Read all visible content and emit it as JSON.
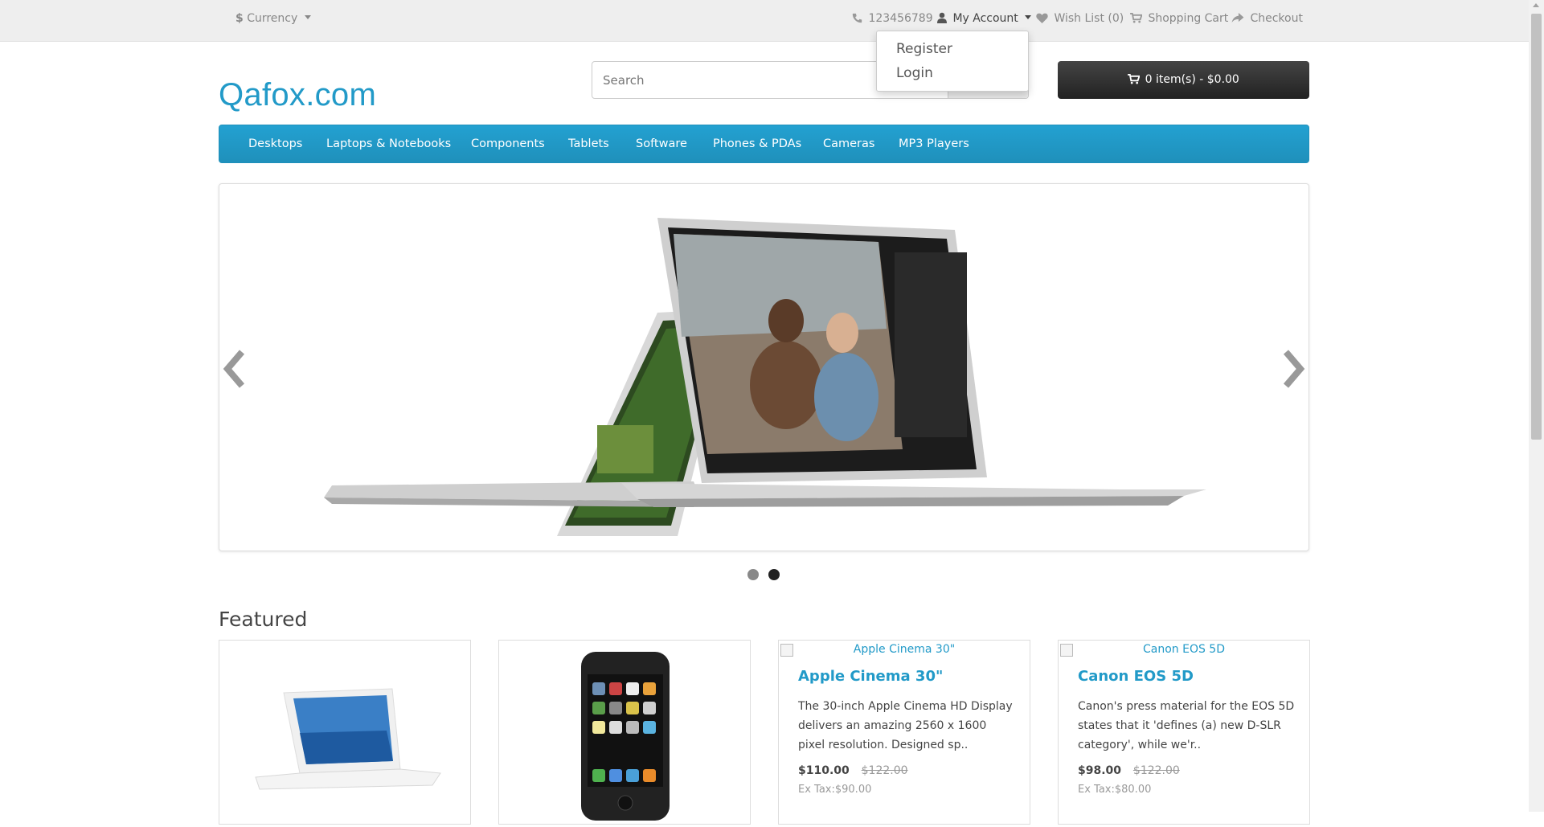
{
  "topbar": {
    "currency_label": "Currency",
    "phone": "123456789",
    "my_account": "My Account",
    "wish_list": "Wish List (0)",
    "shopping_cart": "Shopping Cart",
    "checkout": "Checkout"
  },
  "account_dropdown": {
    "register": "Register",
    "login": "Login"
  },
  "header": {
    "logo": "Qafox.com",
    "search_placeholder": "Search",
    "cart_button": "0 item(s) - $0.00"
  },
  "menu": {
    "items": [
      "Desktops",
      "Laptops & Notebooks",
      "Components",
      "Tablets",
      "Software",
      "Phones & PDAs",
      "Cameras",
      "MP3 Players"
    ]
  },
  "slider": {
    "active_slide": 2,
    "slide_count": 2
  },
  "featured": {
    "title": "Featured",
    "products": [
      {
        "name": "",
        "image": "macbook"
      },
      {
        "name": "",
        "image": "iphone"
      },
      {
        "alt": "Apple Cinema 30\"",
        "name": "Apple Cinema 30\"",
        "description": "The 30-inch Apple Cinema HD Display delivers an amazing 2560 x 1600 pixel resolution. Designed sp..",
        "price": "$110.00",
        "old_price": "$122.00",
        "tax": "Ex Tax:$90.00"
      },
      {
        "alt": "Canon EOS 5D",
        "name": "Canon EOS 5D",
        "description": "Canon's press material for the EOS 5D states that it 'defines (a) new D-SLR category', while we'r..",
        "price": "$98.00",
        "old_price": "$122.00",
        "tax": "Ex Tax:$80.00"
      }
    ]
  },
  "colors": {
    "accent": "#229ac8",
    "topbar_bg": "#eeeeee",
    "cart_button_bg": "#363636"
  }
}
